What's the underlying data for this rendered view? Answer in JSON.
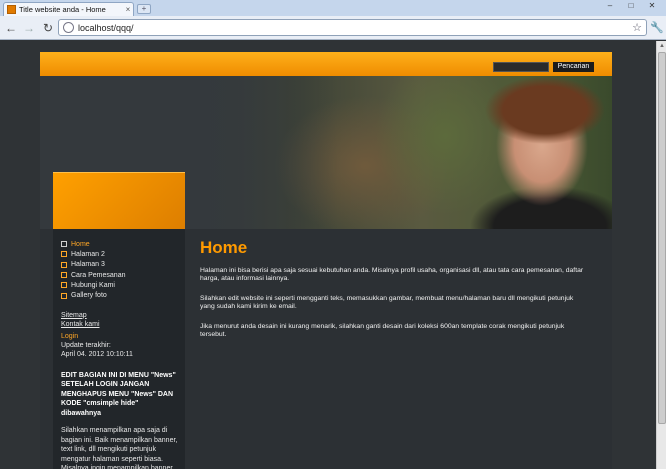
{
  "browser": {
    "tab_title": "Title website anda - Home",
    "tab_close": "×",
    "new_tab": "+",
    "url": "localhost/qqq/",
    "window_controls": {
      "minimize": "–",
      "maximize": "□",
      "close": "✕"
    },
    "nav": {
      "back": "←",
      "forward": "→",
      "reload": "↻",
      "bookmark": "☆",
      "menu": "🔧"
    },
    "scroll_up": "▲"
  },
  "search": {
    "button_label": "Pencarian",
    "value": ""
  },
  "sidebar": {
    "menu": [
      {
        "label": "Home",
        "active": true
      },
      {
        "label": "Halaman 2",
        "active": false
      },
      {
        "label": "Halaman 3",
        "active": false
      },
      {
        "label": "Cara Pemesanan",
        "active": false
      },
      {
        "label": "Hubungi Kami",
        "active": false
      },
      {
        "label": "Gallery foto",
        "active": false
      }
    ],
    "links": {
      "sitemap": "Sitemap",
      "contact": "Kontak kami",
      "login": "Login"
    },
    "update_label": "Update terakhir:",
    "update_date": "April 04. 2012 10:10:11",
    "news_heading": "EDIT BAGIAN INI DI MENU \"News\" SETELAH LOGIN JANGAN MENGHAPUS MENU \"News\" DAN KODE \"cmsimple hide\" dibawahnya",
    "news_body": "Silahkan menampilkan apa saja di bagian ini. Baik menampilkan banner, text link, dll mengikuti petunjuk mengatur halaman seperti biasa. Misalnya ingin menampilkan banner, hanya masukkan gambar lalu diberi"
  },
  "main": {
    "title": "Home",
    "paragraphs": [
      "Halaman ini bisa berisi apa saja sesuai kebutuhan anda. Misalnya profil usaha, organisasi dll, atau tata cara pemesanan, daftar harga, atau informasi lainnya.",
      "Silahkan edit website ini seperti mengganti teks, memasukkan gambar, membuat menu/halaman baru dll mengikuti petunjuk yang sudah kami kirim ke email.",
      "Jika menurut anda desain ini kurang menarik, silahkan ganti desain dari koleksi 600an template corak mengikuti petunjuk tersebut."
    ]
  },
  "colors": {
    "accent": "#ff9a00",
    "page_bg": "#2f3336",
    "sidebar_bg": "#22262a"
  }
}
